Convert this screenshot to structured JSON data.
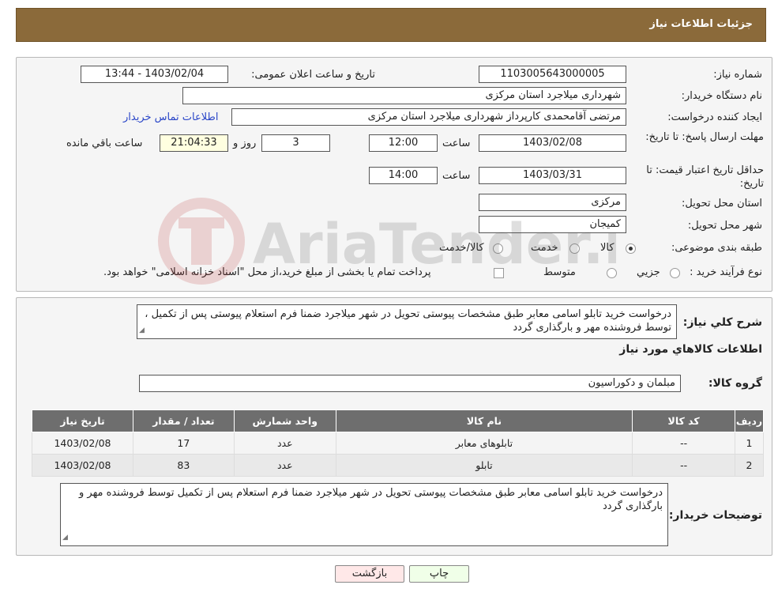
{
  "header": {
    "title": "جزئیات اطلاعات نیاز"
  },
  "form": {
    "need_number_label": "شماره نیاز:",
    "need_number": "1103005643000005",
    "announce_label": "تاریخ و ساعت اعلان عمومی:",
    "announce_value": "1403/02/04 - 13:44",
    "buyer_org_label": "نام دستگاه خریدار:",
    "buyer_org": "شهرداری میلاجرد استان مرکزی",
    "creator_label": "ایجاد کننده درخواست:",
    "creator": "مرتضی  آقامحمدی  کارپرداز  شهرداری میلاجرد استان مرکزی",
    "contact_link": "اطلاعات تماس خریدار",
    "deadline_label": "مهلت ارسال پاسخ: تا تاریخ:",
    "deadline_date": "1403/02/08",
    "time_label": "ساعت",
    "deadline_time": "12:00",
    "days": "3",
    "days_label": "روز و",
    "remaining": "21:04:33",
    "remaining_label": "ساعت باقي مانده",
    "validity_label": "حداقل تاریخ اعتبار قیمت: تا تاریخ:",
    "validity_date": "1403/03/31",
    "validity_time": "14:00",
    "province_label": "استان محل تحویل:",
    "province": "مرکزی",
    "city_label": "شهر محل تحویل:",
    "city": "کمیجان",
    "category_label": "طبقه بندی موضوعی:",
    "cat_goods": "کالا",
    "cat_service": "خدمت",
    "cat_both": "کالا/خدمت",
    "process_label": "نوع فرآیند خرید :",
    "proc_small": "جزیي",
    "proc_medium": "متوسط",
    "proc_note": "پرداخت تمام یا بخشی از مبلغ خرید،از محل \"اسناد خزانه اسلامی\" خواهد بود."
  },
  "watermark": {
    "text": "AriaTender.neT"
  },
  "details": {
    "desc_label": "شرح کلي نیاز:",
    "desc_text": "درخواست خرید تابلو اسامی معابر طبق مشخصات پیوستی  تحویل در شهر میلاجرد ضمنا فرم استعلام پیوستی پس از تکمیل ، توسط فروشنده مهر و بارگذاری گردد",
    "goods_info_title": "اطلاعات کالاهاي مورد نیاز",
    "goods_group_label": "گروه کالا:",
    "goods_group": "مبلمان و دکوراسیون",
    "table": {
      "headers": [
        "ردیف",
        "کد کالا",
        "نام کالا",
        "واحد شمارش",
        "تعداد / مقدار",
        "تاریخ نیاز"
      ],
      "rows": [
        [
          "1",
          "--",
          "تابلوهای معابر",
          "عدد",
          "17",
          "1403/02/08"
        ],
        [
          "2",
          "--",
          "تابلو",
          "عدد",
          "83",
          "1403/02/08"
        ]
      ]
    },
    "buyer_notes_label": "توضیحات خریدار:",
    "buyer_notes": "درخواست خرید تابلو اسامی معابر طبق مشخصات پیوستی  تحویل در شهر میلاجرد ضمنا فرم استعلام پس از تکمیل توسط فروشنده  مهر و بارگذاری گردد"
  },
  "buttons": {
    "print": "چاپ",
    "back": "بازگشت"
  }
}
